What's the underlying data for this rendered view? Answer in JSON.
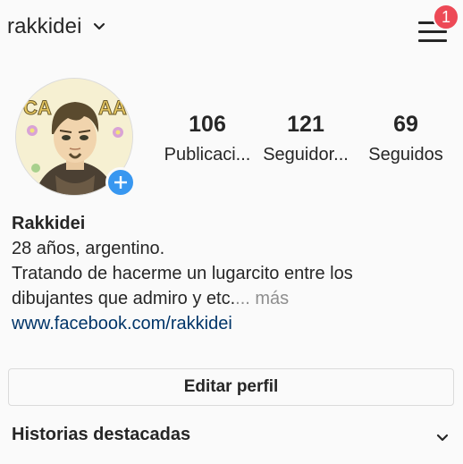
{
  "header": {
    "username": "rakkidei",
    "chevron_icon": "chevron-down-icon",
    "menu_icon": "hamburger-menu-icon",
    "notification_count": "1"
  },
  "profile": {
    "stats": [
      {
        "value": "106",
        "label": "Publicaci..."
      },
      {
        "value": "121",
        "label": "Seguidor..."
      },
      {
        "value": "69",
        "label": "Seguidos"
      }
    ],
    "add_story_icon": "plus-icon"
  },
  "bio": {
    "name": "Rakkidei",
    "line1": "28 años, argentino.",
    "line2": "Tratando de hacerme un lugarcito entre los",
    "line3": "dibujantes que admiro y etc.",
    "more": "... más",
    "link": "www.facebook.com/rakkidei"
  },
  "actions": {
    "edit_profile": "Editar perfil"
  },
  "highlights": {
    "title": "Historias destacadas"
  },
  "colors": {
    "background": "#fafafa",
    "text": "#262626",
    "muted": "#8e8e8e",
    "link": "#003569",
    "badge": "#ed4956",
    "accent": "#3897f0",
    "border": "#dbdbdb"
  }
}
